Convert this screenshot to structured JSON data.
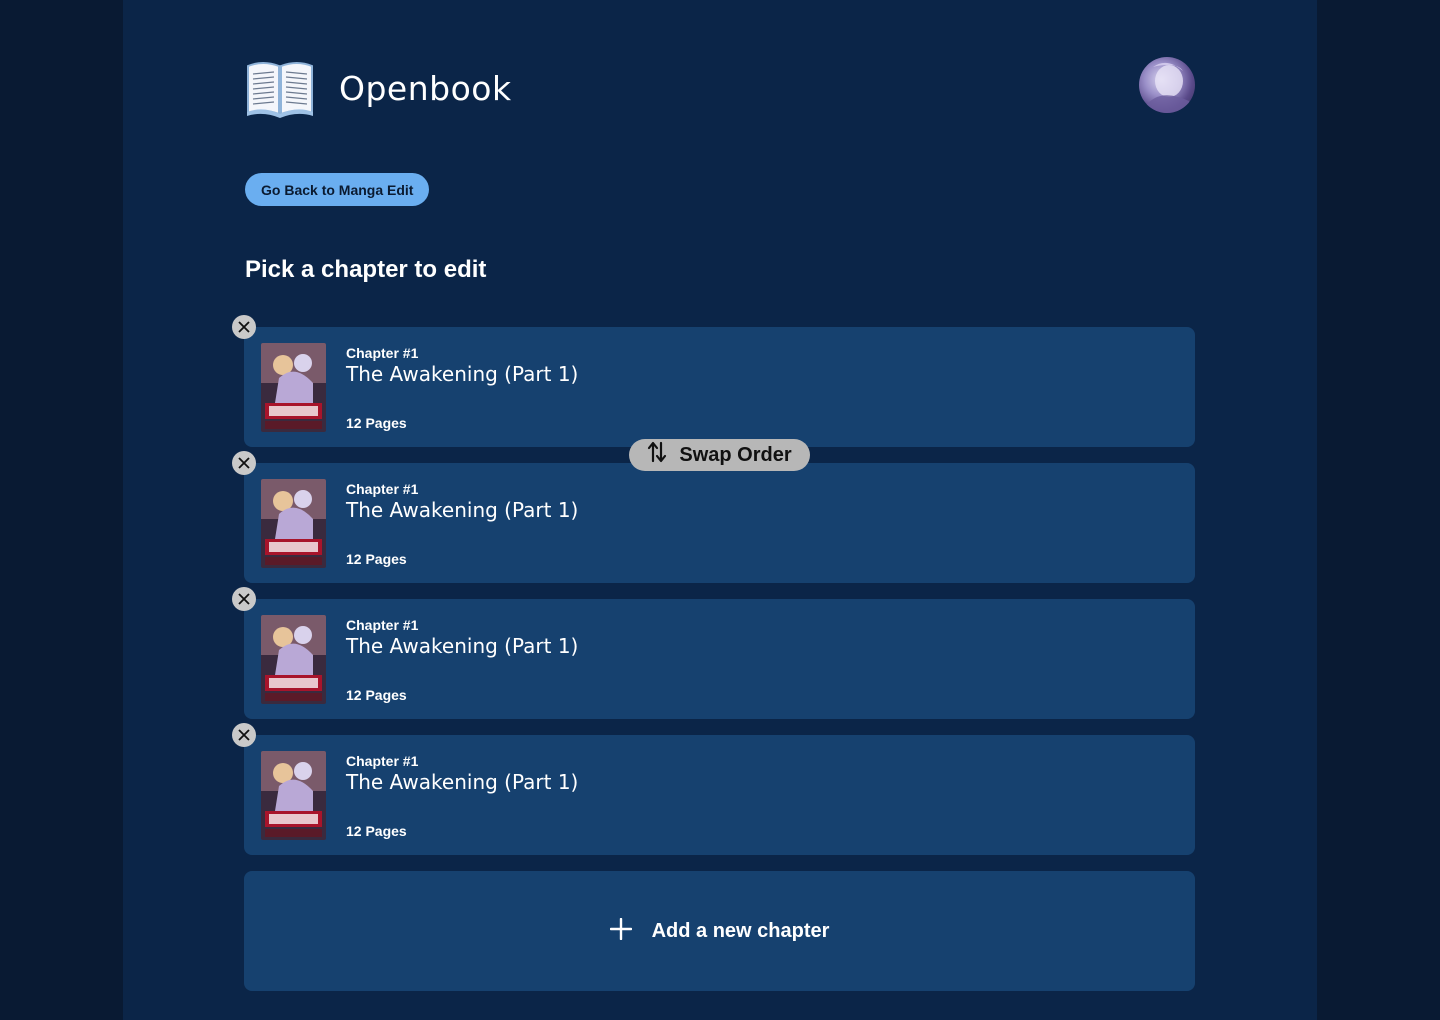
{
  "app": {
    "name": "Openbook",
    "logo_icon": "open-book-icon",
    "avatar_icon": "user-avatar"
  },
  "actions": {
    "back_label": "Go Back to Manga Edit",
    "swap_label": "Swap Order",
    "add_label": "Add a new chapter"
  },
  "page": {
    "heading": "Pick a chapter to edit"
  },
  "chapters": [
    {
      "number": "Chapter #1",
      "title": "The Awakening (Part 1)",
      "pages": "12 Pages"
    },
    {
      "number": "Chapter #1",
      "title": "The Awakening (Part 1)",
      "pages": "12 Pages"
    },
    {
      "number": "Chapter #1",
      "title": "The Awakening (Part 1)",
      "pages": "12 Pages"
    },
    {
      "number": "Chapter #1",
      "title": "The Awakening (Part 1)",
      "pages": "12 Pages"
    }
  ],
  "colors": {
    "background": "#091a33",
    "page": "#0b2548",
    "card": "#16416f",
    "accent_button": "#6aaef0",
    "swap_button": "#b7b7b7",
    "remove_button": "#c9c9c9"
  }
}
